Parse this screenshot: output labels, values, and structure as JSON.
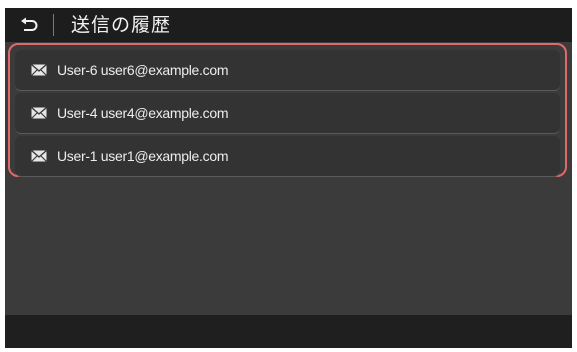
{
  "header": {
    "title": "送信の履歴",
    "back_icon": "return-arrow-icon"
  },
  "history": {
    "items": [
      {
        "icon": "envelope-icon",
        "label": "User-6 user6@example.com"
      },
      {
        "icon": "envelope-icon",
        "label": "User-4 user4@example.com"
      },
      {
        "icon": "envelope-icon",
        "label": "User-1 user1@example.com"
      }
    ]
  },
  "colors": {
    "screen_bg": "#3b3b3b",
    "header_bg": "#1d1d1d",
    "row_bg": "#333333",
    "highlight_border": "#e06a6a",
    "footer_bg": "#1f1f1f",
    "text": "#ededed"
  }
}
